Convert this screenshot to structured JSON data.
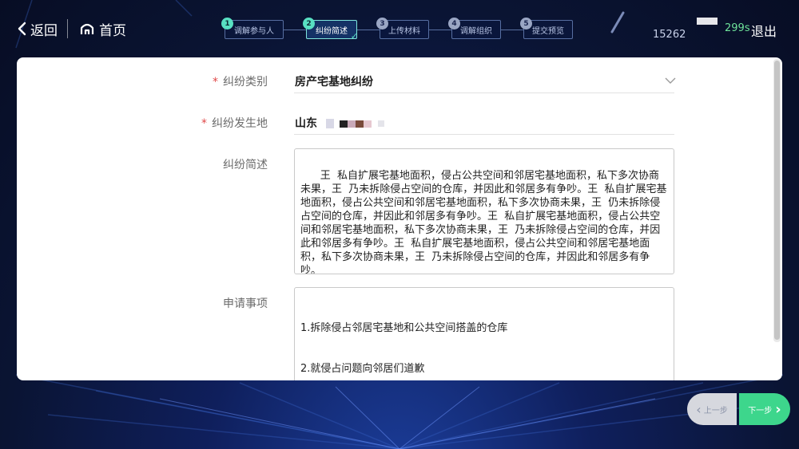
{
  "header": {
    "back_label": "返回",
    "home_label": "首页",
    "steps": [
      {
        "num": "1",
        "label": "调解参与人"
      },
      {
        "num": "2",
        "label": "纠纷简述"
      },
      {
        "num": "3",
        "label": "上传材料"
      },
      {
        "num": "4",
        "label": "调解组织"
      },
      {
        "num": "5",
        "label": "提交预览"
      }
    ],
    "user_id": "15262",
    "timer": "299s",
    "logout_label": "退出"
  },
  "form": {
    "category": {
      "required_mark": "*",
      "label": "纠纷类别",
      "value": "房产宅基地纠纷"
    },
    "location": {
      "required_mark": "*",
      "label": "纠纷发生地",
      "value": "山东"
    },
    "summary": {
      "label": "纠纷简述",
      "value": "王  私自扩展宅基地面积，侵占公共空间和邻居宅基地面积，私下多次协商未果，王  乃未拆除侵占空间的仓库，并因此和邻居多有争吵。王  私自扩展宅基地面积，侵占公共空间和邻居宅基地面积，私下多次协商未果，王  仍未拆除侵占空间的仓库，并因此和邻居多有争吵。王  私自扩展宅基地面积，侵占公共空间和邻居宅基地面积，私下多次协商未果，王  乃未拆除侵占空间的仓库，并因此和邻居多有争吵。王  私自扩展宅基地面积，侵占公共空间和邻居宅基地面积，私下多次协商未果，王  乃未拆除侵占空间的仓库，并因此和邻居多有争吵。"
    },
    "request": {
      "label": "申请事项",
      "line1": "1.拆除侵占邻居宅基地和公共空间搭盖的仓库",
      "line2": "2.就侵占问题向邻居们道歉"
    }
  },
  "footer": {
    "prev_label": "上一步",
    "next_label": "下一步"
  },
  "colors": {
    "accent_green": "#3dd68c",
    "step_active": "#58e0c2",
    "required_red": "#e04848",
    "timer_green": "#6ee39a"
  }
}
